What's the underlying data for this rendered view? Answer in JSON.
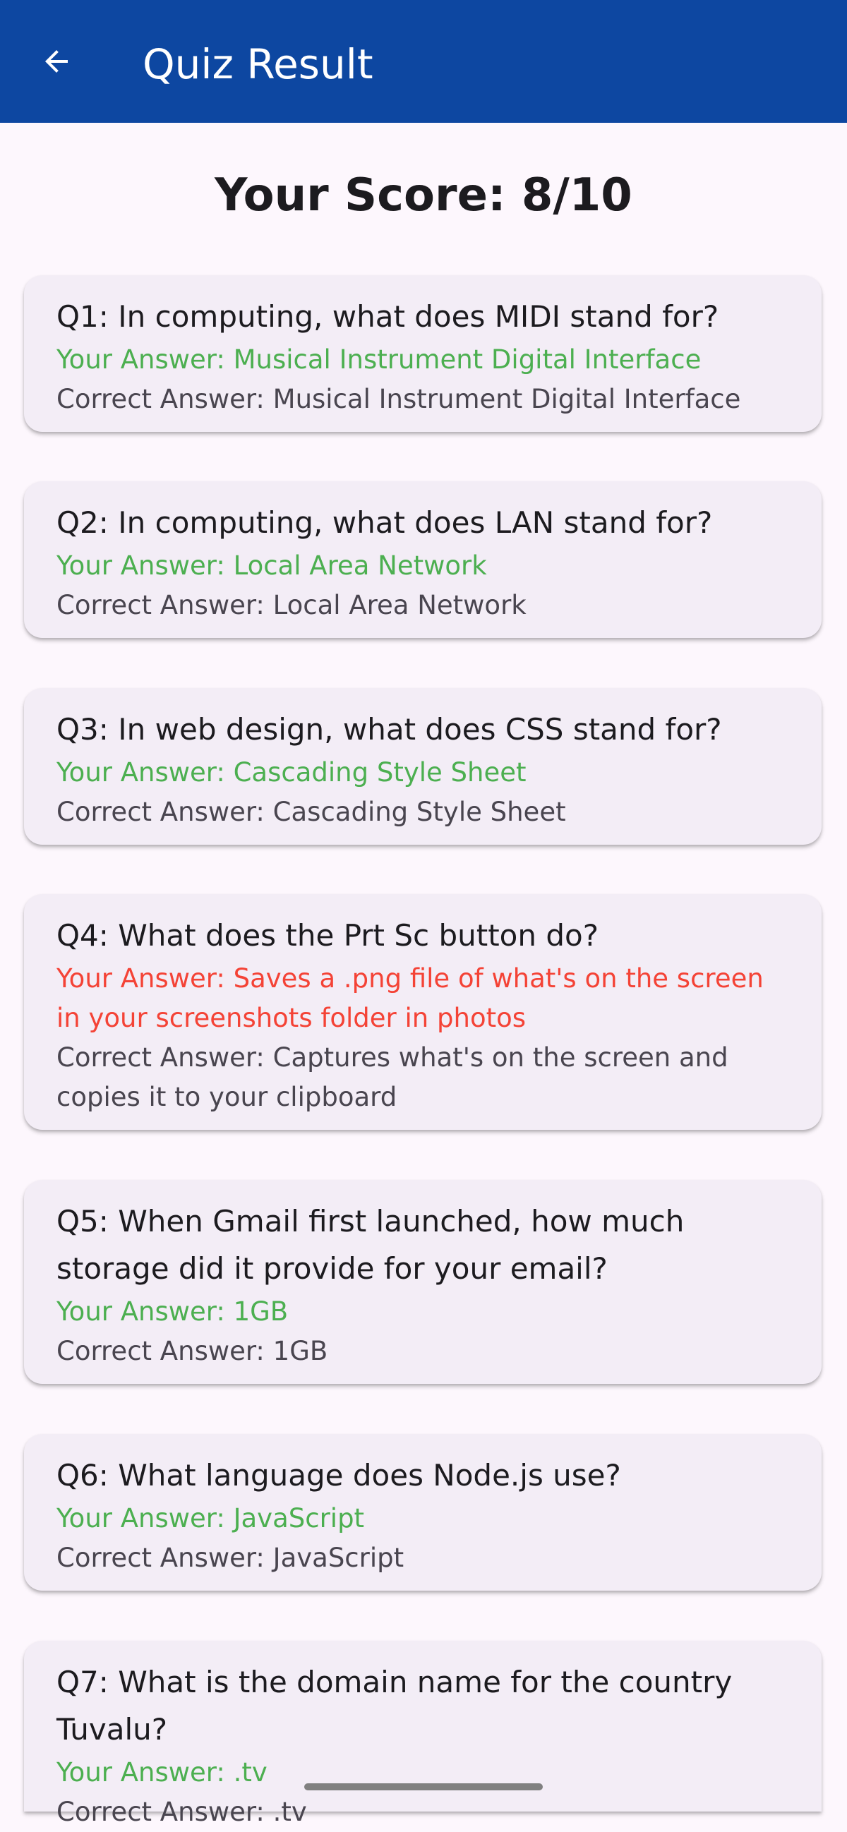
{
  "app_bar": {
    "title": "Quiz Result",
    "background": "#0d47a1",
    "back_icon": "arrow-left-icon"
  },
  "score_text": "Your Score: 8/10",
  "colors": {
    "correct": "#4caf50",
    "incorrect": "#f44336",
    "question_text": "#1c1b1f",
    "secondary_text": "#49454f",
    "card_background": "#f3edf6",
    "page_background": "#fdf7fd"
  },
  "questions": [
    {
      "question": "Q1: In computing, what does MIDI stand for?",
      "your_answer": "Your Answer: Musical Instrument Digital Interface",
      "correct_answer": "Correct Answer: Musical Instrument Digital Interface",
      "is_correct": true
    },
    {
      "question": "Q2: In computing, what does LAN stand for?",
      "your_answer": "Your Answer: Local Area Network",
      "correct_answer": "Correct Answer: Local Area Network",
      "is_correct": true
    },
    {
      "question": "Q3: In web design, what does CSS stand for?",
      "your_answer": "Your Answer: Cascading Style Sheet",
      "correct_answer": "Correct Answer: Cascading Style Sheet",
      "is_correct": true
    },
    {
      "question": "Q4: What does the Prt Sc button do?",
      "your_answer": "Your Answer: Saves a .png file of what's on the screen in your screenshots folder in photos",
      "correct_answer": "Correct Answer: Captures what's on the screen and copies it to your clipboard",
      "is_correct": false
    },
    {
      "question": "Q5: When Gmail first launched, how much storage did it provide for your email?",
      "your_answer": "Your Answer: 1GB",
      "correct_answer": "Correct Answer: 1GB",
      "is_correct": true
    },
    {
      "question": "Q6: What language does Node.js use?",
      "your_answer": "Your Answer: JavaScript",
      "correct_answer": "Correct Answer: JavaScript",
      "is_correct": true
    },
    {
      "question": "Q7: What is the domain name for the country Tuvalu?",
      "your_answer": "Your Answer: .tv",
      "correct_answer": "Correct Answer: .tv",
      "is_correct": true
    }
  ]
}
